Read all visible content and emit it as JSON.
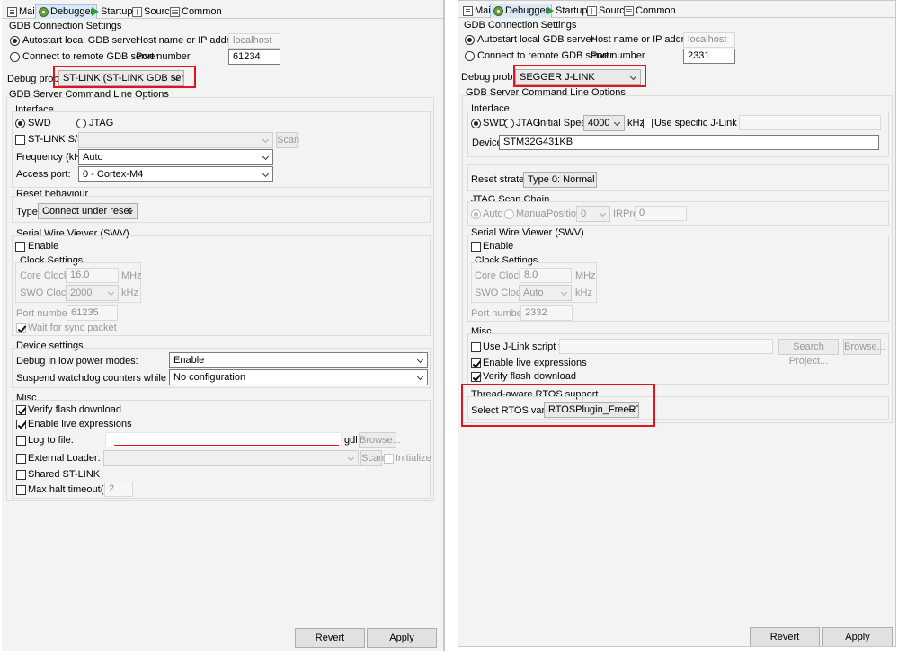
{
  "colors": {
    "highlight": "#e0141e",
    "active_tab": "#dbe9f7",
    "panel_bg": "#f3f3f3"
  },
  "tabs": [
    {
      "label": "Main",
      "icon": "main-tab-icon"
    },
    {
      "label": "Debugger",
      "icon": "debug-icon"
    },
    {
      "label": "Startup",
      "icon": "startup-icon"
    },
    {
      "label": "Source",
      "icon": "source-icon"
    },
    {
      "label": "Common",
      "icon": "common-icon"
    }
  ],
  "left": {
    "gdb": {
      "title": "GDB Connection Settings",
      "autostart": "Autostart local GDB server",
      "remote": "Connect to remote GDB server",
      "host_label": "Host name or IP address",
      "host_value": "localhost",
      "port_label": "Port number",
      "port_value": "61234"
    },
    "probe": {
      "label": "Debug probe",
      "value": "ST-LINK (ST-LINK GDB server)"
    },
    "server_title": "GDB Server Command Line Options",
    "interface": {
      "title": "Interface",
      "swd": "SWD",
      "jtag": "JTAG"
    },
    "stlink_sn": {
      "label": "ST-LINK S/N",
      "scan": "Scan"
    },
    "frequency": {
      "label": "Frequency (kHz):",
      "value": "Auto"
    },
    "access_port": {
      "label": "Access port:",
      "value": "0 - Cortex-M4"
    },
    "reset": {
      "title": "Reset behaviour",
      "label": "Type:",
      "value": "Connect under reset"
    },
    "swv": {
      "title": "Serial Wire Viewer (SWV)",
      "enable": "Enable",
      "clock_title": "Clock Settings",
      "core_label": "Core Clock:",
      "core_value": "16.0",
      "mhz": "MHz",
      "swo_label": "SWO Clock:",
      "swo_value": "2000",
      "khz": "kHz",
      "port_label": "Port number:",
      "port_value": "61235",
      "wait": "Wait for sync packet"
    },
    "device": {
      "title": "Device settings",
      "lowpower_label": "Debug in low power modes:",
      "lowpower_value": "Enable",
      "watchdog_label": "Suspend watchdog counters while halted:",
      "watchdog_value": "No configuration"
    },
    "misc": {
      "title": "Misc",
      "verify": "Verify flash download",
      "live": "Enable live expressions",
      "log": "Log to file:",
      "log_suffix": "gdl",
      "browse": "Browse...",
      "loader": "External Loader:",
      "scan": "Scan",
      "initialize": "Initialize",
      "shared": "Shared ST-LINK",
      "halt": "Max halt timeout(s):",
      "halt_value": "2"
    },
    "buttons": {
      "revert": "Revert",
      "apply": "Apply"
    }
  },
  "right": {
    "gdb": {
      "title": "GDB Connection Settings",
      "autostart": "Autostart local GDB server",
      "remote": "Connect to remote GDB server",
      "host_label": "Host name or IP address",
      "host_value": "localhost",
      "port_label": "Port number",
      "port_value": "2331"
    },
    "probe": {
      "label": "Debug probe",
      "value": "SEGGER J-LINK"
    },
    "server_title": "GDB Server Command Line Options",
    "interface": {
      "title": "Interface",
      "swd": "SWD",
      "jtag": "JTAG",
      "speed_label": "Initial Speed",
      "speed_value": "4000",
      "khz": "kHz",
      "specific": "Use specific J-Link S/N",
      "device_label": "Device",
      "device_value": "STM32G431KB"
    },
    "reset": {
      "label": "Reset strategy",
      "value": "Type 0: Normal"
    },
    "jtag_chain": {
      "title": "JTAG Scan Chain",
      "auto": "Auto",
      "manual": "Manual",
      "position_label": "Position",
      "position_value": "0",
      "irpre_label": "IRPre",
      "irpre_value": "0"
    },
    "swv": {
      "title": "Serial Wire Viewer (SWV)",
      "enable": "Enable",
      "clock_title": "Clock Settings",
      "core_label": "Core Clock:",
      "core_value": "8.0",
      "mhz": "MHz",
      "swo_label": "SWO Clock:",
      "swo_value": "Auto",
      "khz": "kHz",
      "port_label": "Port number:",
      "port_value": "2332"
    },
    "misc": {
      "title": "Misc",
      "script": "Use J-Link script file",
      "search": "Search Project...",
      "browse": "Browse...",
      "live": "Enable live expressions",
      "verify": "Verify flash download"
    },
    "rtos": {
      "title": "Thread-aware RTOS support",
      "label": "Select RTOS variant:",
      "value": "RTOSPlugin_FreeRTOS"
    },
    "buttons": {
      "revert": "Revert",
      "apply": "Apply"
    }
  }
}
